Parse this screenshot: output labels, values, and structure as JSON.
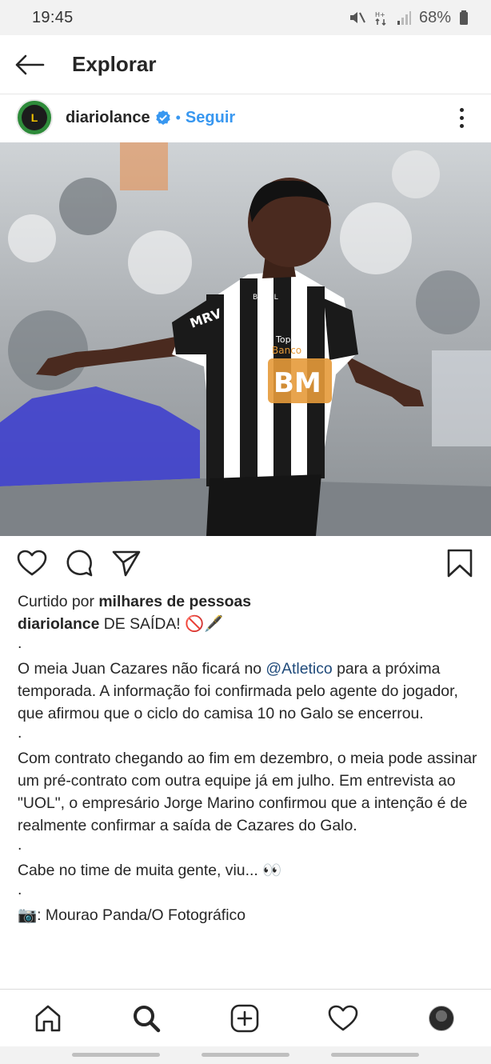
{
  "status_bar": {
    "time": "19:45",
    "battery": "68%",
    "icons": [
      "mute-icon",
      "data-arrows-icon",
      "signal-icon",
      "battery-icon"
    ]
  },
  "header": {
    "title": "Explorar",
    "back_icon": "arrow-left-icon"
  },
  "post": {
    "username": "diariolance",
    "verified_icon": "verified-badge-icon",
    "separator": "•",
    "follow_label": "Seguir",
    "more_icon": "more-vertical-icon",
    "image_description_icon": "post-photo",
    "jersey_text": [
      "Topper",
      "Banco",
      "BMG",
      "MRV",
      "BRASIL"
    ],
    "actions": [
      "heart-icon",
      "comment-icon",
      "share-icon",
      "bookmark-icon"
    ],
    "likes": {
      "prefix": "Curtido por",
      "bold": "milhares de pessoas"
    },
    "caption": {
      "username": "diariolance",
      "headline": "DE SAÍDA!",
      "headline_emoji": "🚫🖋️",
      "dot1": ".",
      "p1_before": "O meia Juan Cazares não ficará no",
      "p1_mention": "@Atletico",
      "p1_after": "para a próxima temporada. A informação foi confirmada pelo agente do jogador, que afirmou que o ciclo do camisa 10 no Galo se encerrou.",
      "dot2": ".",
      "p2": "Com contrato chegando ao fim em dezembro, o meia pode assinar um pré-contrato com outra equipe já em julho. Em entrevista ao \"UOL\", o empresário Jorge Marino confirmou que a intenção é de realmente confirmar a saída de Cazares do Galo.",
      "dot3": ".",
      "p3": "Cabe no time de muita gente, viu... 👀",
      "dot4": ".",
      "credit": "📷: Mourao Panda/O Fotográfico"
    }
  },
  "bottom_nav": {
    "items": [
      "home-icon",
      "search-icon",
      "add-post-icon",
      "activity-heart-icon",
      "profile-avatar"
    ]
  },
  "colors": {
    "accent": "#3897f0",
    "text": "#262626",
    "status_bg": "#f2f2f2"
  }
}
